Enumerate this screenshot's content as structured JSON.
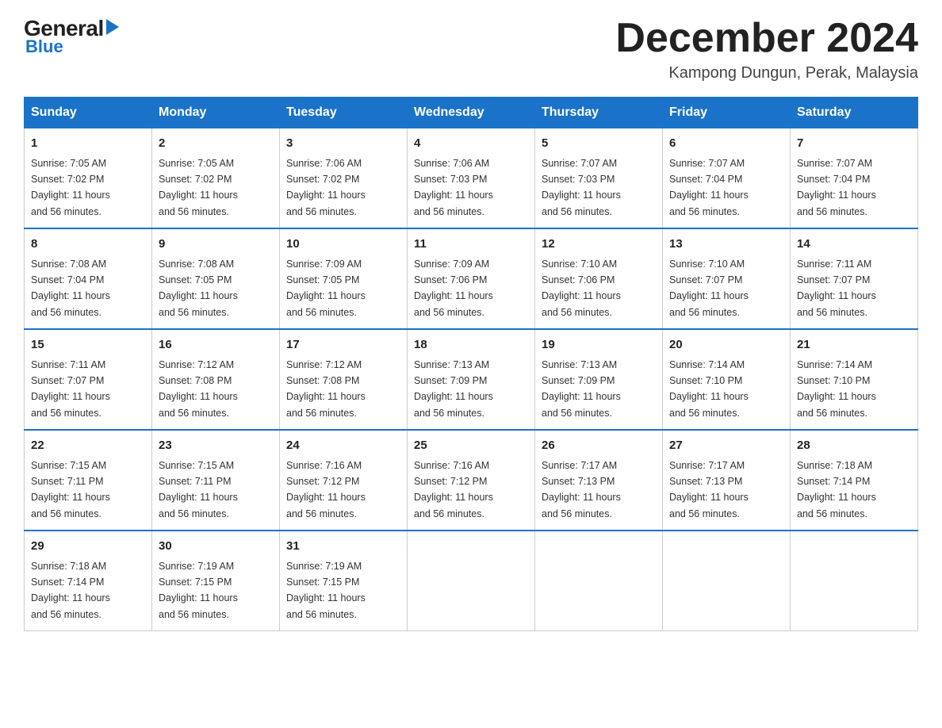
{
  "logo": {
    "general": "General",
    "blue": "Blue"
  },
  "title": "December 2024",
  "location": "Kampong Dungun, Perak, Malaysia",
  "days_of_week": [
    "Sunday",
    "Monday",
    "Tuesday",
    "Wednesday",
    "Thursday",
    "Friday",
    "Saturday"
  ],
  "weeks": [
    [
      {
        "day": 1,
        "sunrise": "7:05 AM",
        "sunset": "7:02 PM",
        "daylight": "11 hours and 56 minutes."
      },
      {
        "day": 2,
        "sunrise": "7:05 AM",
        "sunset": "7:02 PM",
        "daylight": "11 hours and 56 minutes."
      },
      {
        "day": 3,
        "sunrise": "7:06 AM",
        "sunset": "7:02 PM",
        "daylight": "11 hours and 56 minutes."
      },
      {
        "day": 4,
        "sunrise": "7:06 AM",
        "sunset": "7:03 PM",
        "daylight": "11 hours and 56 minutes."
      },
      {
        "day": 5,
        "sunrise": "7:07 AM",
        "sunset": "7:03 PM",
        "daylight": "11 hours and 56 minutes."
      },
      {
        "day": 6,
        "sunrise": "7:07 AM",
        "sunset": "7:04 PM",
        "daylight": "11 hours and 56 minutes."
      },
      {
        "day": 7,
        "sunrise": "7:07 AM",
        "sunset": "7:04 PM",
        "daylight": "11 hours and 56 minutes."
      }
    ],
    [
      {
        "day": 8,
        "sunrise": "7:08 AM",
        "sunset": "7:04 PM",
        "daylight": "11 hours and 56 minutes."
      },
      {
        "day": 9,
        "sunrise": "7:08 AM",
        "sunset": "7:05 PM",
        "daylight": "11 hours and 56 minutes."
      },
      {
        "day": 10,
        "sunrise": "7:09 AM",
        "sunset": "7:05 PM",
        "daylight": "11 hours and 56 minutes."
      },
      {
        "day": 11,
        "sunrise": "7:09 AM",
        "sunset": "7:06 PM",
        "daylight": "11 hours and 56 minutes."
      },
      {
        "day": 12,
        "sunrise": "7:10 AM",
        "sunset": "7:06 PM",
        "daylight": "11 hours and 56 minutes."
      },
      {
        "day": 13,
        "sunrise": "7:10 AM",
        "sunset": "7:07 PM",
        "daylight": "11 hours and 56 minutes."
      },
      {
        "day": 14,
        "sunrise": "7:11 AM",
        "sunset": "7:07 PM",
        "daylight": "11 hours and 56 minutes."
      }
    ],
    [
      {
        "day": 15,
        "sunrise": "7:11 AM",
        "sunset": "7:07 PM",
        "daylight": "11 hours and 56 minutes."
      },
      {
        "day": 16,
        "sunrise": "7:12 AM",
        "sunset": "7:08 PM",
        "daylight": "11 hours and 56 minutes."
      },
      {
        "day": 17,
        "sunrise": "7:12 AM",
        "sunset": "7:08 PM",
        "daylight": "11 hours and 56 minutes."
      },
      {
        "day": 18,
        "sunrise": "7:13 AM",
        "sunset": "7:09 PM",
        "daylight": "11 hours and 56 minutes."
      },
      {
        "day": 19,
        "sunrise": "7:13 AM",
        "sunset": "7:09 PM",
        "daylight": "11 hours and 56 minutes."
      },
      {
        "day": 20,
        "sunrise": "7:14 AM",
        "sunset": "7:10 PM",
        "daylight": "11 hours and 56 minutes."
      },
      {
        "day": 21,
        "sunrise": "7:14 AM",
        "sunset": "7:10 PM",
        "daylight": "11 hours and 56 minutes."
      }
    ],
    [
      {
        "day": 22,
        "sunrise": "7:15 AM",
        "sunset": "7:11 PM",
        "daylight": "11 hours and 56 minutes."
      },
      {
        "day": 23,
        "sunrise": "7:15 AM",
        "sunset": "7:11 PM",
        "daylight": "11 hours and 56 minutes."
      },
      {
        "day": 24,
        "sunrise": "7:16 AM",
        "sunset": "7:12 PM",
        "daylight": "11 hours and 56 minutes."
      },
      {
        "day": 25,
        "sunrise": "7:16 AM",
        "sunset": "7:12 PM",
        "daylight": "11 hours and 56 minutes."
      },
      {
        "day": 26,
        "sunrise": "7:17 AM",
        "sunset": "7:13 PM",
        "daylight": "11 hours and 56 minutes."
      },
      {
        "day": 27,
        "sunrise": "7:17 AM",
        "sunset": "7:13 PM",
        "daylight": "11 hours and 56 minutes."
      },
      {
        "day": 28,
        "sunrise": "7:18 AM",
        "sunset": "7:14 PM",
        "daylight": "11 hours and 56 minutes."
      }
    ],
    [
      {
        "day": 29,
        "sunrise": "7:18 AM",
        "sunset": "7:14 PM",
        "daylight": "11 hours and 56 minutes."
      },
      {
        "day": 30,
        "sunrise": "7:19 AM",
        "sunset": "7:15 PM",
        "daylight": "11 hours and 56 minutes."
      },
      {
        "day": 31,
        "sunrise": "7:19 AM",
        "sunset": "7:15 PM",
        "daylight": "11 hours and 56 minutes."
      },
      null,
      null,
      null,
      null
    ]
  ],
  "labels": {
    "sunrise": "Sunrise:",
    "sunset": "Sunset:",
    "daylight": "Daylight:"
  }
}
